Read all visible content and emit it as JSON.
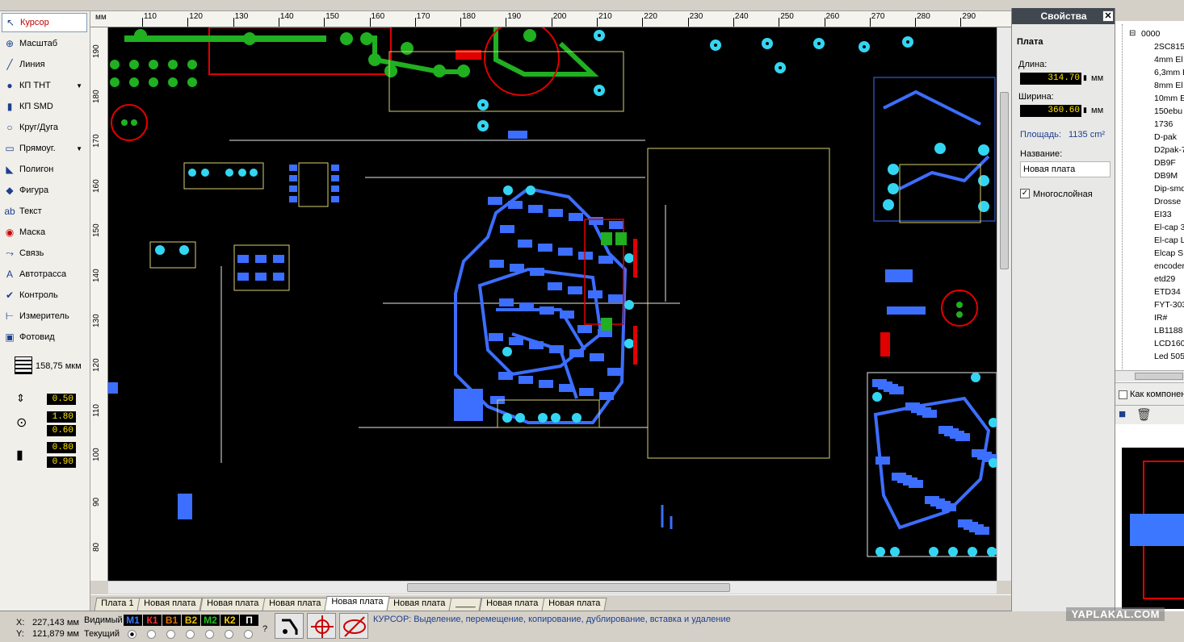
{
  "tools": [
    {
      "label": "Курсор",
      "icon": "cursor-arrow-icon",
      "active": true
    },
    {
      "label": "Масштаб",
      "icon": "zoom-icon"
    },
    {
      "label": "Линия",
      "icon": "line-icon"
    },
    {
      "label": "КП THT",
      "icon": "tht-pad-icon",
      "dropdown": true
    },
    {
      "label": "КП SMD",
      "icon": "smd-pad-icon"
    },
    {
      "label": "Круг/Дуга",
      "icon": "circle-arc-icon"
    },
    {
      "label": "Прямоуг.",
      "icon": "rectangle-icon",
      "dropdown": true
    },
    {
      "label": "Полигон",
      "icon": "polygon-icon"
    },
    {
      "label": "Фигура",
      "icon": "shape-icon"
    },
    {
      "label": "Текст",
      "icon": "text-icon"
    },
    {
      "label": "Маска",
      "icon": "mask-icon"
    },
    {
      "label": "Связь",
      "icon": "connection-icon"
    },
    {
      "label": "Автотрасса",
      "icon": "autoroute-icon"
    },
    {
      "label": "Контроль",
      "icon": "drc-check-icon"
    },
    {
      "label": "Измеритель",
      "icon": "measure-icon"
    },
    {
      "label": "Фотовид",
      "icon": "photoview-icon"
    }
  ],
  "grid": {
    "value": "158,75 мкм"
  },
  "track_width": {
    "value": "0.50"
  },
  "pad_size": {
    "outer": "1.80",
    "inner": "0.60"
  },
  "smd_size": {
    "width": "0.80",
    "height": "0.90"
  },
  "ruler": {
    "unit": "мм",
    "top_ticks": [
      "110",
      "120",
      "130",
      "140",
      "150",
      "160",
      "170",
      "180",
      "190",
      "200",
      "210",
      "220",
      "230",
      "240",
      "250",
      "260",
      "270",
      "280",
      "290"
    ],
    "left_ticks": [
      "190",
      "180",
      "170",
      "160",
      "150",
      "140",
      "130",
      "120",
      "110",
      "100",
      "90",
      "80"
    ]
  },
  "tabs": [
    "Плата 1",
    "Новая плата",
    "Новая плата",
    "Новая плата",
    "Новая плата",
    "Новая плата",
    "____",
    "Новая плата",
    "Новая плата"
  ],
  "active_tab_index": 4,
  "status": {
    "x_label": "X:",
    "x_value": "227,143 мм",
    "y_label": "Y:",
    "y_value": "121,879 мм",
    "visible_label": "Видимый",
    "current_label": "Текущий",
    "hint": "КУРСОР: Выделение, перемещение, копирование, дублирование, вставка и удаление",
    "question": "?"
  },
  "layers": [
    {
      "name": "М1",
      "color": "#3c78ff"
    },
    {
      "name": "К1",
      "color": "#ff3030"
    },
    {
      "name": "В1",
      "color": "#e07000"
    },
    {
      "name": "В2",
      "color": "#e8c000"
    },
    {
      "name": "М2",
      "color": "#20c020"
    },
    {
      "name": "К2",
      "color": "#ffd000"
    },
    {
      "name": "П",
      "color": "#ffffff"
    }
  ],
  "properties": {
    "title": "Свойства",
    "section": "Плата",
    "length_label": "Длина:",
    "length_value": "314.70",
    "width_label": "Ширина:",
    "width_value": "360.60",
    "unit": "мм",
    "area_label": "Площадь:",
    "area_value": "1135 cm²",
    "name_label": "Название:",
    "name_value": "Новая плата",
    "multilayer_label": "Многослойная",
    "multilayer_checked": true
  },
  "library": {
    "root": "0000",
    "items": [
      "2SC815",
      "4mm El",
      "6,3mm E",
      "8mm El",
      "10mm E",
      "150ebu",
      "1736",
      "D-pak",
      "D2pak-7",
      "DB9F",
      "DB9M",
      "Dip-smd",
      "Drosse",
      "EI33",
      "El-cap 3",
      "El-cap L",
      "Elcap S",
      "encoder",
      "etd29",
      "ETD34",
      "FYT-303",
      "IR#",
      "LB1188",
      "LCD160",
      "Led 505"
    ],
    "as_component_label": "Как компонент"
  },
  "watermark": "YAPLAKAL.COM"
}
